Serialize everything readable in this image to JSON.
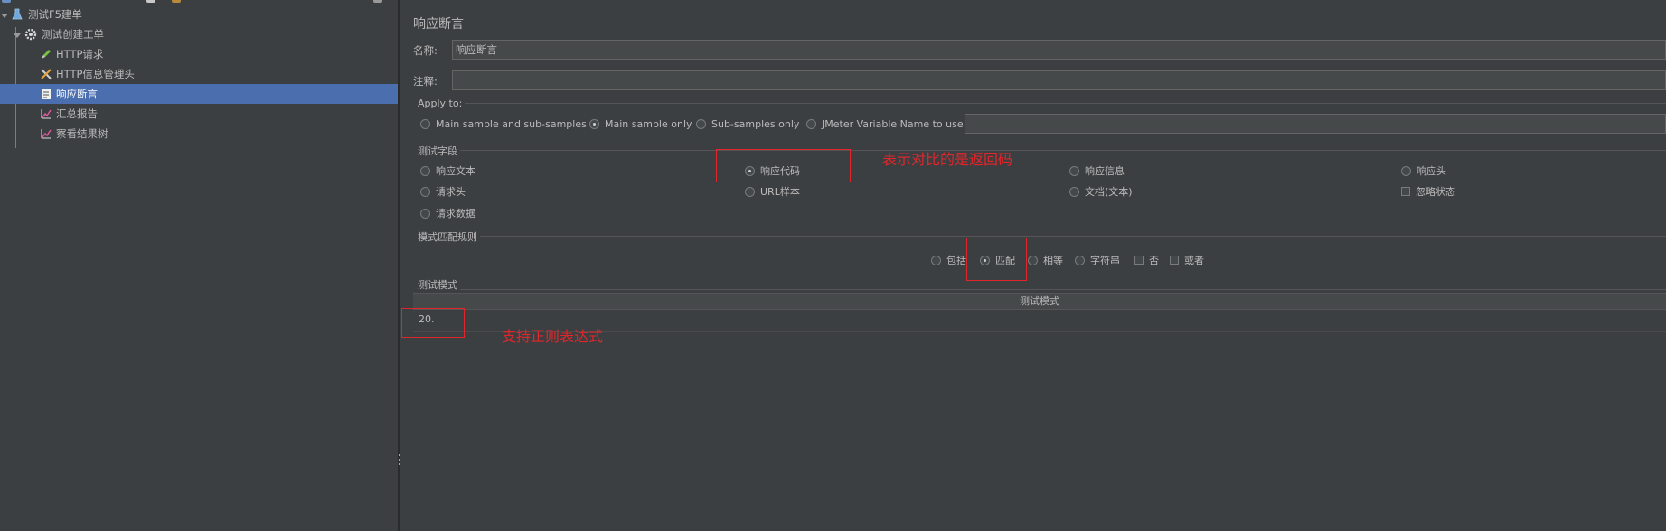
{
  "tree": {
    "items": [
      {
        "label": "测试F5建单",
        "icon": "flask-icon",
        "expanded": true
      },
      {
        "label": "测试创建工单",
        "icon": "gear-icon",
        "expanded": true
      },
      {
        "label": "HTTP请求",
        "icon": "pen-icon"
      },
      {
        "label": "HTTP信息管理头",
        "icon": "tools-icon"
      },
      {
        "label": "响应断言",
        "icon": "assertion-icon",
        "selected": true
      },
      {
        "label": "汇总报告",
        "icon": "chart-icon"
      },
      {
        "label": "察看结果树",
        "icon": "chart-icon"
      }
    ],
    "selected_color": "#4b6eaf"
  },
  "panel": {
    "title": "响应断言",
    "name_label": "名称:",
    "name_value": "响应断言",
    "comment_label": "注释:",
    "comment_value": ""
  },
  "apply_to": {
    "title": "Apply to:",
    "options": [
      {
        "label": "Main sample and sub-samples",
        "selected": false
      },
      {
        "label": "Main sample only",
        "selected": true
      },
      {
        "label": "Sub-samples only",
        "selected": false
      },
      {
        "label": "JMeter Variable Name to use",
        "selected": false
      }
    ],
    "variable_value": ""
  },
  "test_field": {
    "title": "测试字段",
    "options": [
      {
        "label": "响应文本",
        "type": "radio",
        "selected": false
      },
      {
        "label": "响应代码",
        "type": "radio",
        "selected": true
      },
      {
        "label": "响应信息",
        "type": "radio",
        "selected": false
      },
      {
        "label": "响应头",
        "type": "radio",
        "selected": false
      },
      {
        "label": "请求头",
        "type": "radio",
        "selected": false
      },
      {
        "label": "URL样本",
        "type": "radio",
        "selected": false
      },
      {
        "label": "文档(文本)",
        "type": "radio",
        "selected": false
      },
      {
        "label": "忽略状态",
        "type": "checkbox",
        "selected": false
      },
      {
        "label": "请求数据",
        "type": "radio",
        "selected": false
      }
    ]
  },
  "match_rule": {
    "title": "模式匹配规则",
    "options": [
      {
        "label": "包括",
        "type": "radio",
        "selected": false
      },
      {
        "label": "匹配",
        "type": "radio",
        "selected": true
      },
      {
        "label": "相等",
        "type": "radio",
        "selected": false
      },
      {
        "label": "字符串",
        "type": "radio",
        "selected": false
      },
      {
        "label": "否",
        "type": "checkbox",
        "selected": false
      },
      {
        "label": "或者",
        "type": "checkbox",
        "selected": false
      }
    ]
  },
  "patterns": {
    "title": "测试模式",
    "column_header": "测试模式",
    "rows": [
      "20."
    ]
  },
  "annotations": {
    "color": "#e0262b",
    "response_code_note": "表示对比的是返回码",
    "regex_note": "支持正则表达式"
  }
}
